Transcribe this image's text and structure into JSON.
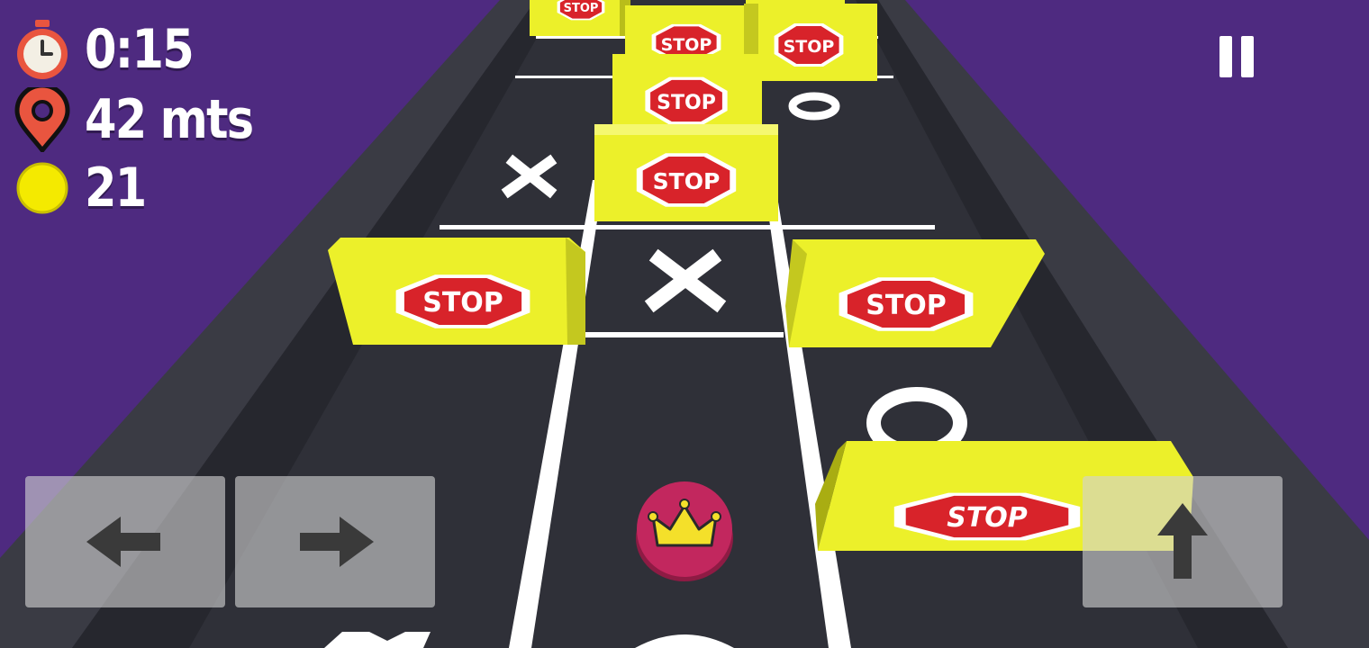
{
  "hud": {
    "timer": "0:15",
    "distance": "42 mts",
    "coins": "21"
  },
  "icons": {
    "timer": "stopwatch-icon",
    "distance": "location-pin-icon",
    "coins": "coin-icon",
    "pause": "pause-icon",
    "left": "arrow-left-icon",
    "right": "arrow-right-icon",
    "up": "arrow-up-icon",
    "player": "crown-icon"
  },
  "board": {
    "barrier_label": "STOP",
    "x_mark": "X",
    "o_mark": "O"
  },
  "colors": {
    "background": "#4e2a80",
    "track": "#2f3038",
    "barrier": "#ecf02a",
    "stop_sign": "#d8232a",
    "player": "#c2275e",
    "crown": "#f4e02a"
  }
}
